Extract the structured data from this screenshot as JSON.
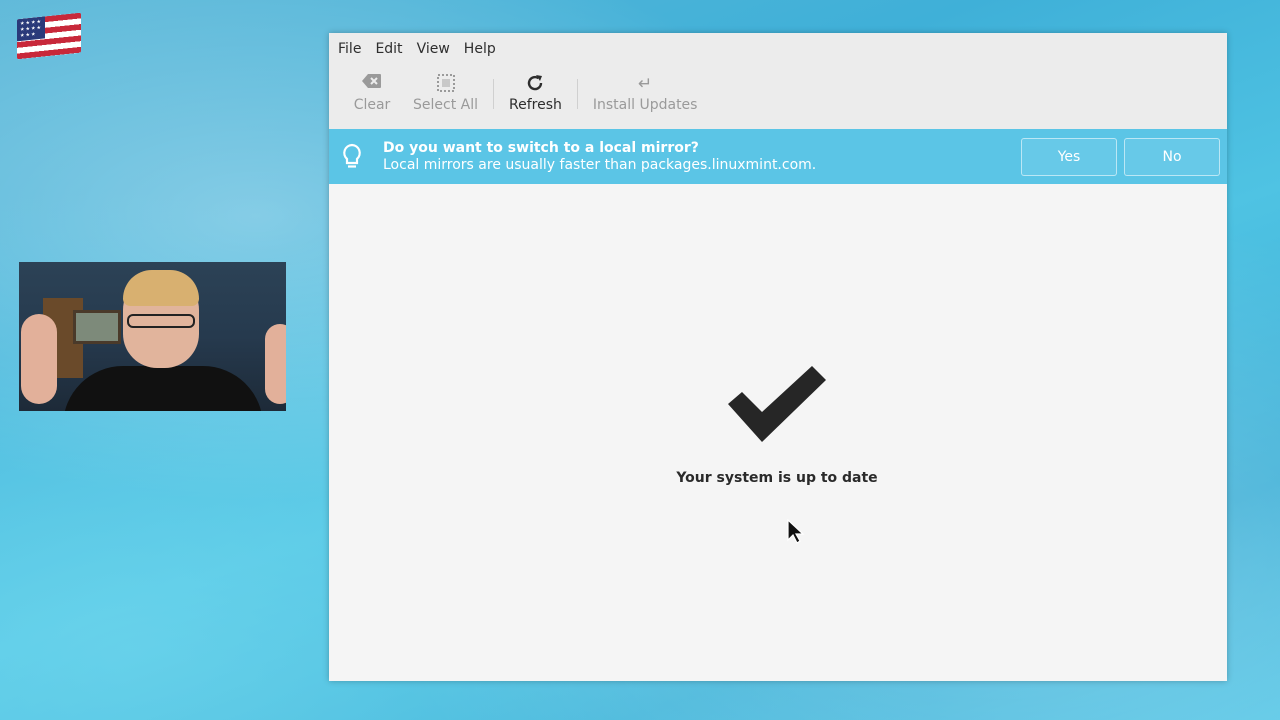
{
  "desktop": {
    "overlays": {
      "flag_icon": "us-flag-icon",
      "webcam": "presenter-webcam-feed"
    }
  },
  "window": {
    "menu": [
      {
        "label": "File"
      },
      {
        "label": "Edit"
      },
      {
        "label": "View"
      },
      {
        "label": "Help"
      }
    ],
    "toolbar": {
      "buttons": [
        {
          "label": "Clear",
          "icon": "backspace-clear-icon",
          "enabled": false
        },
        {
          "label": "Select All",
          "icon": "select-all-icon",
          "enabled": false
        },
        {
          "label": "Refresh",
          "icon": "refresh-icon",
          "enabled": true
        },
        {
          "label": "Install Updates",
          "icon": "install-return-icon",
          "enabled": false
        }
      ]
    },
    "infobar": {
      "icon": "lightbulb-icon",
      "title": "Do you want to switch to a local mirror?",
      "message": "Local mirrors are usually faster than packages.linuxmint.com.",
      "yes_label": "Yes",
      "no_label": "No",
      "color": "#5bc5e6"
    },
    "status": {
      "icon": "checkmark-icon",
      "message": "Your system is up to date"
    }
  }
}
